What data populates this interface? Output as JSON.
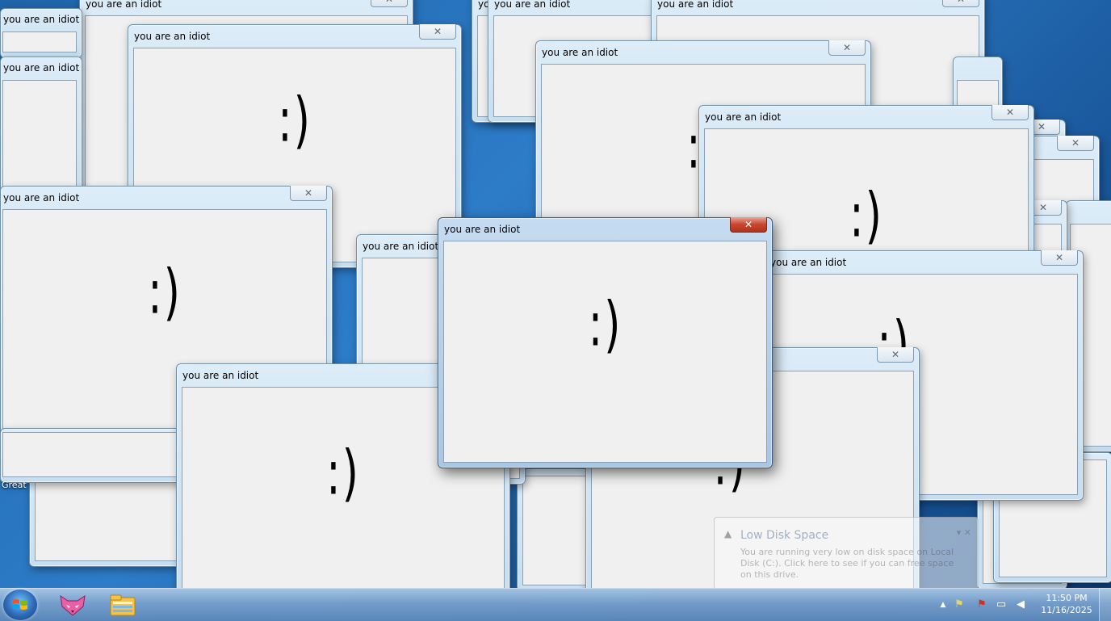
{
  "window": {
    "title": "you are an idiot",
    "content": ":)",
    "close_glyph": "✕"
  },
  "desktop": {
    "label": "Great"
  },
  "notification": {
    "title": "Low Disk Space",
    "body": "You are running very low on disk space on Local Disk (C:). Click here to see if you can free space on this drive.",
    "icon": "warning-icon"
  },
  "taskbar": {
    "start_icon": "windows-logo-icon",
    "apps": [
      {
        "name": "fox-app-icon"
      },
      {
        "name": "windows-explorer-icon"
      }
    ],
    "tray": {
      "icons": [
        "show-hidden-icons-arrow",
        "action-center-icon",
        "flag-error-icon",
        "network-icon",
        "volume-muted-icon"
      ],
      "time": "11:50 PM",
      "date": "11/16/2025"
    }
  }
}
